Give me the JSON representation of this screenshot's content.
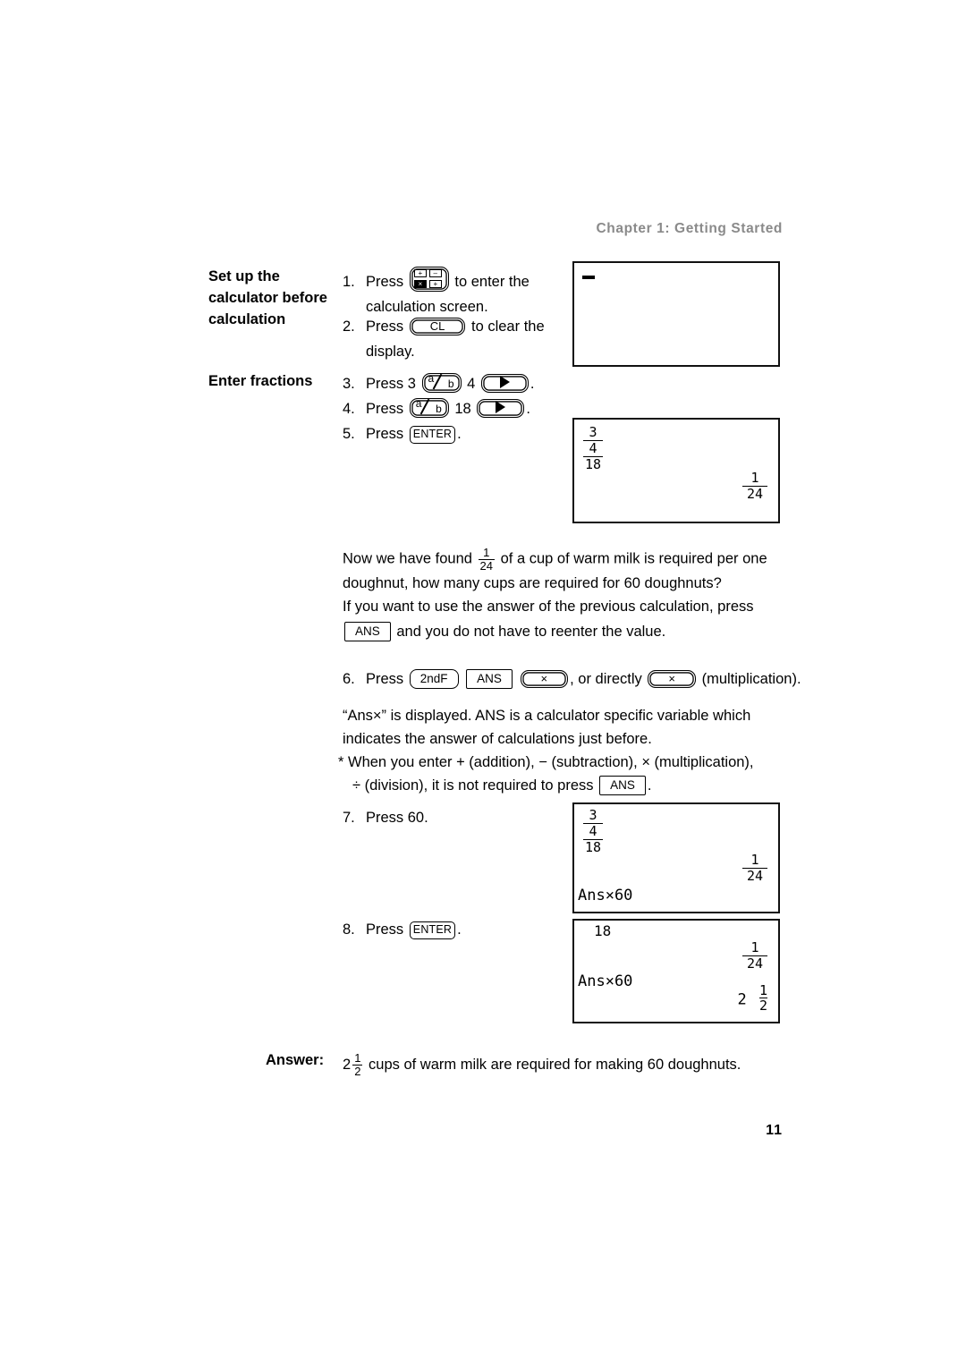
{
  "document": {
    "chapter_header": "Chapter 1: Getting Started",
    "page_number": "11"
  },
  "headings": {
    "setup": "Set up the calculator before calculation",
    "fractions": "Enter fractions"
  },
  "steps": [
    {
      "number": "1.",
      "text_before": "Press",
      "key": "calculator-mode-icon",
      "text_after": "to enter the",
      "line2": "calculation screen."
    },
    {
      "number": "2.",
      "text_before": "Press",
      "key": "CL",
      "text_after": "to clear the",
      "line2": "display."
    },
    {
      "number": "3.",
      "text_before": "Press 3",
      "key": "a/b",
      "text_mid": "4",
      "key2": "right-arrow",
      "text_after": "."
    },
    {
      "number": "4.",
      "text_before": "Press",
      "key": "a/b",
      "text_mid": "18",
      "key2": "right-arrow",
      "text_after": "."
    },
    {
      "number": "5.",
      "text_before": "Press",
      "key": "ENTER",
      "text_after": "."
    },
    {
      "number": "6.",
      "text_before": "Press",
      "key": "2ndF",
      "key2": "ANS",
      "key3": "×",
      "text_mid": ", or directly",
      "key4": "×",
      "text_after": "(multiplication)."
    },
    {
      "number": "7.",
      "text_before": "Press 60."
    },
    {
      "number": "8.",
      "text_before": "Press",
      "key": "ENTER",
      "text_after": "."
    }
  ],
  "paragraphs": {
    "p1_a": "Now we have found",
    "p1_frac_num": "1",
    "p1_frac_den": "24",
    "p1_b": "of a cup of warm milk is required per one",
    "p1_line2": "doughnut, how many cups are required for 60 doughnuts?",
    "p2_line1": "If you want to use the answer of the previous calculation, press",
    "p2_key": "ANS",
    "p2_line2_after": "and you do not have to reenter the value.",
    "p3_line1": "“Ans×” is displayed. ANS is a calculator specific variable which",
    "p3_line2": "indicates the answer of calculations just before.",
    "p4_line1": "* When you enter + (addition), − (subtraction), × (multiplication),",
    "p4_line2_before": "÷ (division), it is not required to press",
    "p4_key": "ANS",
    "p4_line2_after": "."
  },
  "screens": [
    {
      "id": "screen-1",
      "caption": "empty calculation screen with cursor",
      "cursor": true,
      "lines": []
    },
    {
      "id": "screen-2",
      "caption": "complex fraction entered with result",
      "complex_numerator_num": "3",
      "complex_numerator_den": "4",
      "complex_denominator": "18",
      "result_num": "1",
      "result_den": "24"
    },
    {
      "id": "screen-3",
      "caption": "Ans multiplied by 60 entered",
      "complex_numerator_num": "3",
      "complex_numerator_den": "4",
      "complex_denominator": "18",
      "result_num": "1",
      "result_den": "24",
      "entry": "Ans×60"
    },
    {
      "id": "screen-4",
      "caption": "final result after ENTER",
      "scrolled_line": "18",
      "result_num": "1",
      "result_den": "24",
      "entry": "Ans×60",
      "final_whole": "2",
      "final_num": "1",
      "final_den": "2"
    }
  ],
  "answer": {
    "label": "Answer:",
    "whole": "2",
    "num": "1",
    "den": "2",
    "text": "cups of warm milk are required for making 60 doughnuts."
  }
}
